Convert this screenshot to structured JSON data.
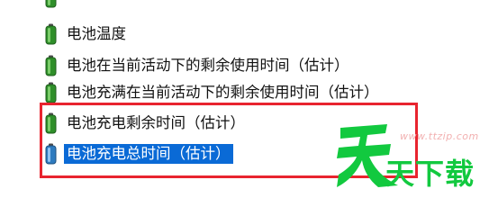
{
  "list": {
    "items": [
      {
        "label": "电池温度"
      },
      {
        "label": "电池在当前活动下的剩余使用时间（估计）"
      },
      {
        "label": "电池充满在当前活动下的剩余使用时间（估计）"
      },
      {
        "label": "电池充电剩余时间（估计）"
      },
      {
        "label": "电池充电总时间（估计）"
      }
    ],
    "selected_index": 4,
    "icon": "battery-icon"
  },
  "watermark": {
    "url": "www.ttzip.com",
    "brand": "天下载"
  },
  "colors": {
    "selection": "#0a6ad6",
    "highlight_box": "#e8242f",
    "battery_green": "#2f8f2a",
    "watermark_green": "#12c93f"
  }
}
